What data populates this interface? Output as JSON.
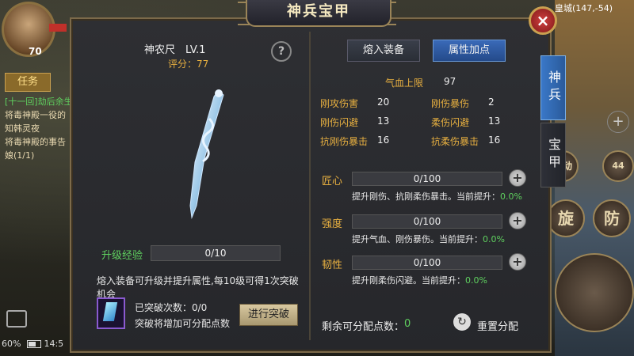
{
  "background": {
    "player_level": "70",
    "task_tab_label": "任务",
    "quest_lines": [
      "[十一回]劫后余生",
      "将毒神殿一役的",
      "知韩灵夜",
      "将毒神殿的事告",
      "娘(1/1)"
    ],
    "map_coords": "皇城(147,-54)",
    "battery_pct": "60%",
    "clock": "14:5",
    "skill_1": "旋",
    "skill_2": "防",
    "auto_label": "自动",
    "potion_count": "44"
  },
  "panel": {
    "title": "神兵宝甲",
    "close_glyph": "×"
  },
  "weapon": {
    "name_level": "神农尺　LV.1",
    "score": "评分：77",
    "help_glyph": "?",
    "exp_label": "升级经验",
    "exp_progress": "0/10",
    "exp_fraction": 0,
    "upgrade_desc": "熔入装备可升级并提升属性,每10级可得1次突破机会",
    "break_count": "已突破次数：0/0",
    "break_hint": "突破将增加可分配点数",
    "break_button": "进行突破"
  },
  "tabs": {
    "equip_button": "熔入装备",
    "attr_button": "属性加点",
    "side_tab_1": "神兵",
    "side_tab_2": "宝甲"
  },
  "stats": {
    "hp_label": "气血上限",
    "hp_value": "97",
    "items": [
      {
        "label": "刚攻伤害",
        "value": "20"
      },
      {
        "label": "刚伤暴伤",
        "value": "2"
      },
      {
        "label": "刚伤闪避",
        "value": "13"
      },
      {
        "label": "柔伤闪避",
        "value": "13"
      },
      {
        "label": "抗刚伤暴击",
        "value": "16"
      },
      {
        "label": "抗柔伤暴击",
        "value": "16"
      }
    ]
  },
  "attributes": [
    {
      "name": "匠心",
      "progress": "0/100",
      "desc": "提升刚伤、抗刚柔伤暴击。当前提升：",
      "pct": "0.0%"
    },
    {
      "name": "强度",
      "progress": "0/100",
      "desc": "提升气血、刚伤暴伤。当前提升：",
      "pct": "0.0%"
    },
    {
      "name": "韧性",
      "progress": "0/100",
      "desc": "提升刚柔伤闪避。当前提升：",
      "pct": "0.0%"
    }
  ],
  "footer": {
    "remain_label": "剩余可分配点数：",
    "remain_value": "0",
    "reset_label": "重置分配"
  },
  "colors": {
    "accent_gold": "#e8b040",
    "accent_green": "#5fd05f",
    "active_tab_blue": "#3a78c8"
  }
}
